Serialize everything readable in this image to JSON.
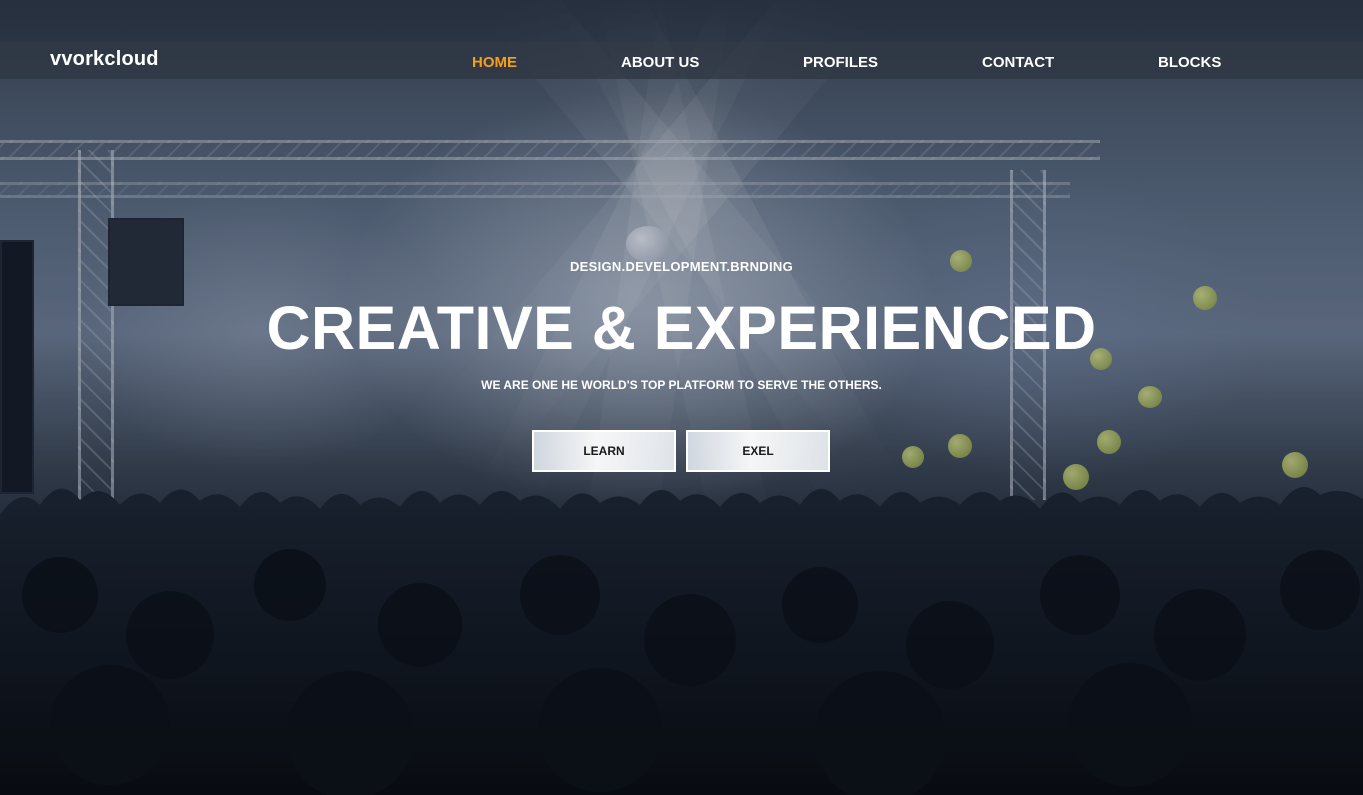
{
  "nav": {
    "brand": "vvorkcloud",
    "items": [
      {
        "label": "HOME",
        "active": true
      },
      {
        "label": "ABOUT US",
        "active": false
      },
      {
        "label": "PROFILES",
        "active": false
      },
      {
        "label": "CONTACT",
        "active": false
      },
      {
        "label": "BLOCKS",
        "active": false
      }
    ]
  },
  "hero": {
    "tagline": "DESIGN.DEVELOPMENT.BRNDING",
    "headline": "CREATIVE & EXPERIENCED",
    "subline": "WE ARE ONE HE WORLD'S TOP PLATFORM TO SERVE THE OTHERS.",
    "buttons": [
      {
        "label": "LEARN"
      },
      {
        "label": "EXEL"
      }
    ],
    "background_image": "concert-crowd-stage-photo"
  },
  "colors": {
    "accent": "#f5a01a",
    "nav_text": "#ffffff",
    "navbar_bg": "#2d343e"
  }
}
